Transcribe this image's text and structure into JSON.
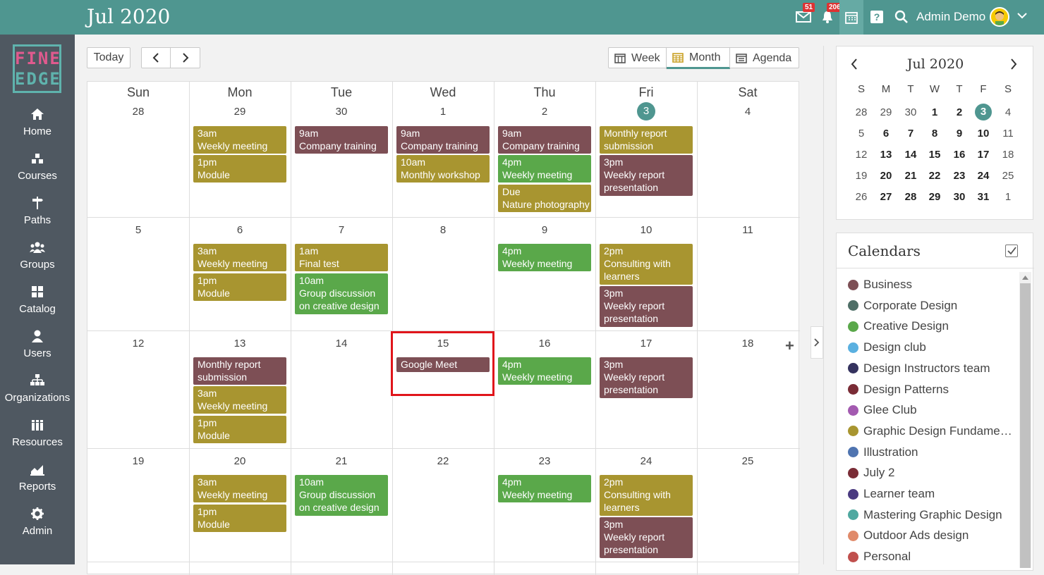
{
  "header": {
    "title": "Jul 2020",
    "messages_badge": "51",
    "notifications_badge": "206",
    "user_name": "Admin Demo",
    "icons": [
      "mail-icon",
      "bell-icon",
      "calendar-icon",
      "help-icon",
      "search-icon",
      "avatar",
      "chevron-down-icon"
    ]
  },
  "logo": {
    "line1": "FINE",
    "line2": "EDGE"
  },
  "nav": [
    {
      "label": "Home",
      "icon": "home-icon"
    },
    {
      "label": "Courses",
      "icon": "courses-icon"
    },
    {
      "label": "Paths",
      "icon": "signpost-icon"
    },
    {
      "label": "Groups",
      "icon": "groups-icon"
    },
    {
      "label": "Catalog",
      "icon": "catalog-icon"
    },
    {
      "label": "Users",
      "icon": "user-icon"
    },
    {
      "label": "Organizations",
      "icon": "org-chart-icon"
    },
    {
      "label": "Resources",
      "icon": "books-icon"
    },
    {
      "label": "Reports",
      "icon": "chart-icon"
    },
    {
      "label": "Admin",
      "icon": "gear-icon"
    }
  ],
  "toolbar": {
    "today_label": "Today",
    "views": [
      "Week",
      "Month",
      "Agenda"
    ],
    "active_view": "Month"
  },
  "colors": {
    "header": "#4f9690",
    "sidebar": "#4f5861",
    "business": "#7d4f55",
    "graphic_design_fundamentals": "#a89530",
    "creative_design": "#5aa84a",
    "highlight": "#e0151b"
  },
  "weekdays": [
    "Sun",
    "Mon",
    "Tue",
    "Wed",
    "Thu",
    "Fri",
    "Sat"
  ],
  "weeks": [
    [
      "28",
      "29",
      "30",
      "1",
      "2",
      "3",
      "4"
    ],
    [
      "5",
      "6",
      "7",
      "8",
      "9",
      "10",
      "11"
    ],
    [
      "12",
      "13",
      "14",
      "15",
      "16",
      "17",
      "18"
    ],
    [
      "19",
      "20",
      "21",
      "22",
      "23",
      "24",
      "25"
    ]
  ],
  "today": "3",
  "events": {
    "w0": {
      "mon": [
        {
          "time": "3am",
          "title": "Weekly meeting"
        },
        {
          "time": "1pm",
          "title": "Module"
        }
      ],
      "tue": [
        {
          "time": "9am",
          "title": "Company training"
        }
      ],
      "wed": [
        {
          "time": "9am",
          "title": "Company training"
        },
        {
          "time": "10am",
          "title": "Monthly workshop"
        }
      ],
      "thu": [
        {
          "time": "9am",
          "title": "Company training"
        },
        {
          "time": "4pm",
          "title": "Weekly meeting"
        },
        {
          "time": "Due",
          "title": "Nature photography"
        }
      ],
      "fri": [
        {
          "title": "Monthly report",
          "title2": "submission"
        },
        {
          "time": "3pm",
          "title": "Weekly report",
          "title2": "presentation"
        }
      ]
    },
    "w1": {
      "mon": [
        {
          "time": "3am",
          "title": "Weekly meeting"
        },
        {
          "time": "1pm",
          "title": "Module"
        }
      ],
      "tue": [
        {
          "time": "1am",
          "title": "Final test"
        },
        {
          "time": "10am",
          "title": "Group discussion",
          "title2": "on creative design"
        }
      ],
      "thu": [
        {
          "time": "4pm",
          "title": "Weekly meeting"
        }
      ],
      "fri": [
        {
          "time": "2pm",
          "title": "Consulting with",
          "title2": "learners"
        },
        {
          "time": "3pm",
          "title": "Weekly report",
          "title2": "presentation"
        }
      ]
    },
    "w2": {
      "mon": [
        {
          "title": "Monthly report",
          "title2": "submission"
        },
        {
          "time": "3am",
          "title": "Weekly meeting"
        },
        {
          "time": "1pm",
          "title": "Module"
        }
      ],
      "wed": [
        {
          "title": "Google Meet"
        }
      ],
      "thu": [
        {
          "time": "4pm",
          "title": "Weekly meeting"
        }
      ],
      "fri": [
        {
          "time": "3pm",
          "title": "Weekly report",
          "title2": "presentation"
        }
      ]
    },
    "w3": {
      "mon": [
        {
          "time": "3am",
          "title": "Weekly meeting"
        },
        {
          "time": "1pm",
          "title": "Module"
        }
      ],
      "tue": [
        {
          "time": "10am",
          "title": "Group discussion",
          "title2": "on creative design"
        }
      ],
      "thu": [
        {
          "time": "4pm",
          "title": "Weekly meeting"
        }
      ],
      "fri": [
        {
          "time": "2pm",
          "title": "Consulting with",
          "title2": "learners"
        },
        {
          "time": "3pm",
          "title": "Weekly report",
          "title2": "presentation"
        }
      ]
    }
  },
  "mini_calendar": {
    "title": "Jul 2020",
    "weekdays": [
      "S",
      "M",
      "T",
      "W",
      "T",
      "F",
      "S"
    ],
    "weeks": [
      [
        "28",
        "29",
        "30",
        "1",
        "2",
        "3",
        "4"
      ],
      [
        "5",
        "6",
        "7",
        "8",
        "9",
        "10",
        "11"
      ],
      [
        "12",
        "13",
        "14",
        "15",
        "16",
        "17",
        "18"
      ],
      [
        "19",
        "20",
        "21",
        "22",
        "23",
        "24",
        "25"
      ],
      [
        "26",
        "27",
        "28",
        "29",
        "30",
        "31",
        "1"
      ]
    ]
  },
  "calendars": {
    "title": "Calendars",
    "items": [
      {
        "name": "Business",
        "color": "#7d4f55"
      },
      {
        "name": "Corporate Design",
        "color": "#4e6e66"
      },
      {
        "name": "Creative Design",
        "color": "#5aa84a"
      },
      {
        "name": "Design club",
        "color": "#5ab0e0"
      },
      {
        "name": "Design Instructors team",
        "color": "#34325e"
      },
      {
        "name": "Design Patterns",
        "color": "#7a2c36"
      },
      {
        "name": "Glee Club",
        "color": "#a35ab0"
      },
      {
        "name": "Graphic Design Fundame…",
        "color": "#a89530"
      },
      {
        "name": "Illustration",
        "color": "#4f74b0"
      },
      {
        "name": "July 2",
        "color": "#7a2c36"
      },
      {
        "name": "Learner team",
        "color": "#4a3a80"
      },
      {
        "name": "Mastering Graphic Design",
        "color": "#4fa8a0"
      },
      {
        "name": "Outdoor Ads design",
        "color": "#e08a6a"
      },
      {
        "name": "Personal",
        "color": "#c0504d"
      }
    ]
  }
}
